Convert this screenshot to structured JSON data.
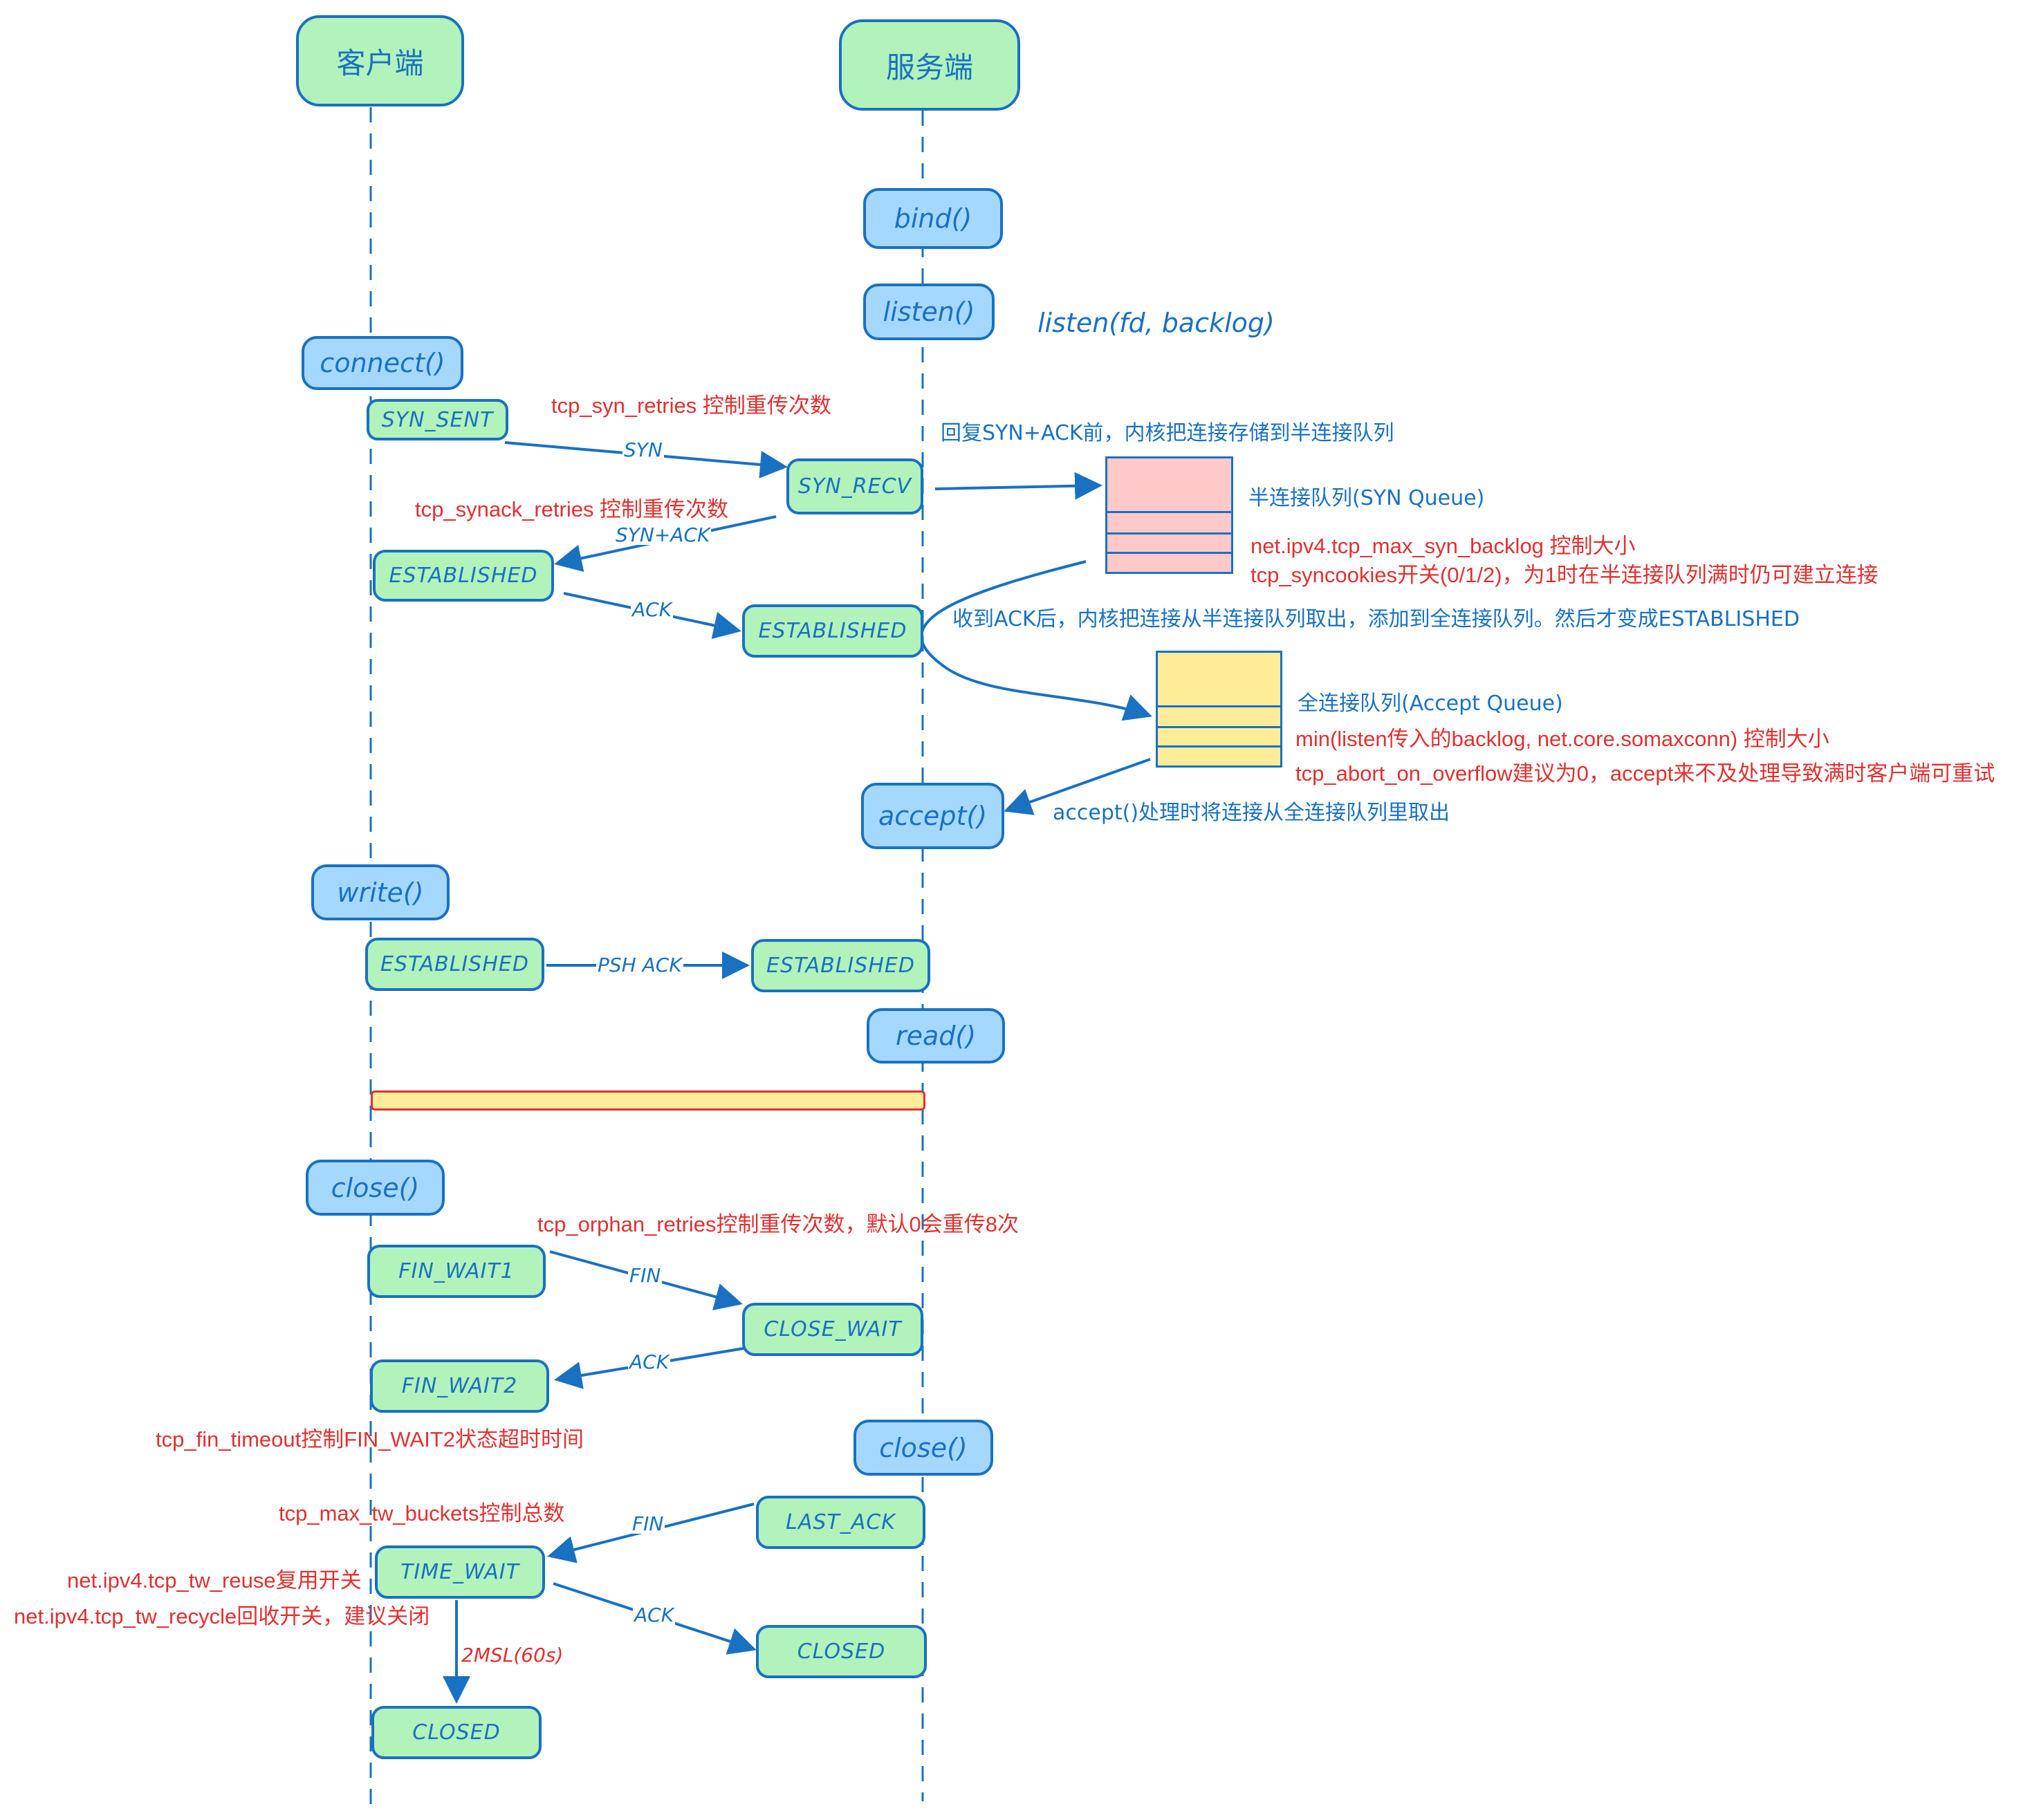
{
  "colors": {
    "stroke": "#1971c2",
    "state_fill": "#b2f2bb",
    "call_fill": "#a5d8ff",
    "syn_queue_fill": "#ffc9c9",
    "accept_queue_fill": "#ffec99",
    "annotation_red": "#e03131"
  },
  "lanes": {
    "client": "客户端",
    "server": "服务端"
  },
  "calls": {
    "bind": "bind()",
    "listen": "listen()",
    "connect": "connect()",
    "accept": "accept()",
    "write": "write()",
    "read": "read()",
    "client_close": "close()",
    "server_close": "close()"
  },
  "states": {
    "syn_sent": "SYN_SENT",
    "syn_recv": "SYN_RECV",
    "client_established_1": "ESTABLISHED",
    "server_established_1": "ESTABLISHED",
    "client_established_2": "ESTABLISHED",
    "server_established_2": "ESTABLISHED",
    "fin_wait1": "FIN_WAIT1",
    "close_wait": "CLOSE_WAIT",
    "fin_wait2": "FIN_WAIT2",
    "last_ack": "LAST_ACK",
    "time_wait": "TIME_WAIT",
    "client_closed": "CLOSED",
    "server_closed": "CLOSED"
  },
  "messages": {
    "syn": "SYN",
    "syn_ack": "SYN+ACK",
    "ack1": "ACK",
    "psh_ack": "PSH ACK",
    "fin1": "FIN",
    "ack2": "ACK",
    "fin2": "FIN",
    "ack3": "ACK",
    "msl": "2MSL(60s)"
  },
  "annotations": {
    "listen_signature": "listen(fd, backlog)",
    "syn_retries": "tcp_syn_retries 控制重传次数",
    "synack_retries": "tcp_synack_retries 控制重传次数",
    "before_synack": "回复SYN+ACK前，内核把连接存储到半连接队列",
    "syn_queue_label": "半连接队列(SYN Queue)",
    "syn_backlog": "net.ipv4.tcp_max_syn_backlog 控制大小",
    "syncookies": "tcp_syncookies开关(0/1/2)，为1时在半连接队列满时仍可建立连接",
    "after_ack": "收到ACK后，内核把连接从半连接队列取出，添加到全连接队列。然后才变成ESTABLISHED",
    "accept_queue_label": "全连接队列(Accept Queue)",
    "accept_queue_size": "min(listen传入的backlog, net.core.somaxconn) 控制大小",
    "abort_on_overflow": "tcp_abort_on_overflow建议为0，accept来不及处理导致满时客户端可重试",
    "accept_takes": "accept()处理时将连接从全连接队列里取出",
    "orphan_retries": "tcp_orphan_retries控制重传次数，默认0会重传8次",
    "fin_timeout": "tcp_fin_timeout控制FIN_WAIT2状态超时时间",
    "tw_buckets": "tcp_max_tw_buckets控制总数",
    "tw_reuse": "net.ipv4.tcp_tw_reuse复用开关",
    "tw_recycle": "net.ipv4.tcp_tw_recycle回收开关，建议关闭"
  }
}
